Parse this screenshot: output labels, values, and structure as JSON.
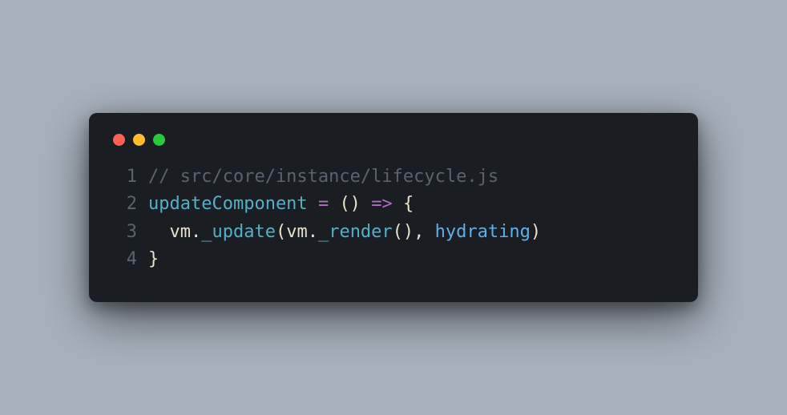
{
  "window": {
    "buttons": [
      "close",
      "minimize",
      "zoom"
    ]
  },
  "code": {
    "lines": [
      {
        "num": "1",
        "tokens": [
          {
            "cls": "tok-comment",
            "text": "// src/core/instance/lifecycle.js"
          }
        ]
      },
      {
        "num": "2",
        "tokens": [
          {
            "cls": "tok-fn",
            "text": "updateComponent"
          },
          {
            "cls": "tok-ident",
            "text": " "
          },
          {
            "cls": "tok-op",
            "text": "="
          },
          {
            "cls": "tok-ident",
            "text": " "
          },
          {
            "cls": "tok-punct",
            "text": "()"
          },
          {
            "cls": "tok-ident",
            "text": " "
          },
          {
            "cls": "tok-op",
            "text": "=>"
          },
          {
            "cls": "tok-ident",
            "text": " "
          },
          {
            "cls": "tok-punct",
            "text": "{"
          }
        ]
      },
      {
        "num": "3",
        "tokens": [
          {
            "cls": "tok-ident",
            "text": "  vm"
          },
          {
            "cls": "tok-punct",
            "text": "."
          },
          {
            "cls": "tok-fn",
            "text": "_update"
          },
          {
            "cls": "tok-punct",
            "text": "("
          },
          {
            "cls": "tok-ident",
            "text": "vm"
          },
          {
            "cls": "tok-punct",
            "text": "."
          },
          {
            "cls": "tok-fn",
            "text": "_render"
          },
          {
            "cls": "tok-punct",
            "text": "(),"
          },
          {
            "cls": "tok-ident",
            "text": " "
          },
          {
            "cls": "tok-param",
            "text": "hydrating"
          },
          {
            "cls": "tok-punct",
            "text": ")"
          }
        ]
      },
      {
        "num": "4",
        "tokens": [
          {
            "cls": "tok-punct",
            "text": "}"
          }
        ]
      }
    ]
  }
}
